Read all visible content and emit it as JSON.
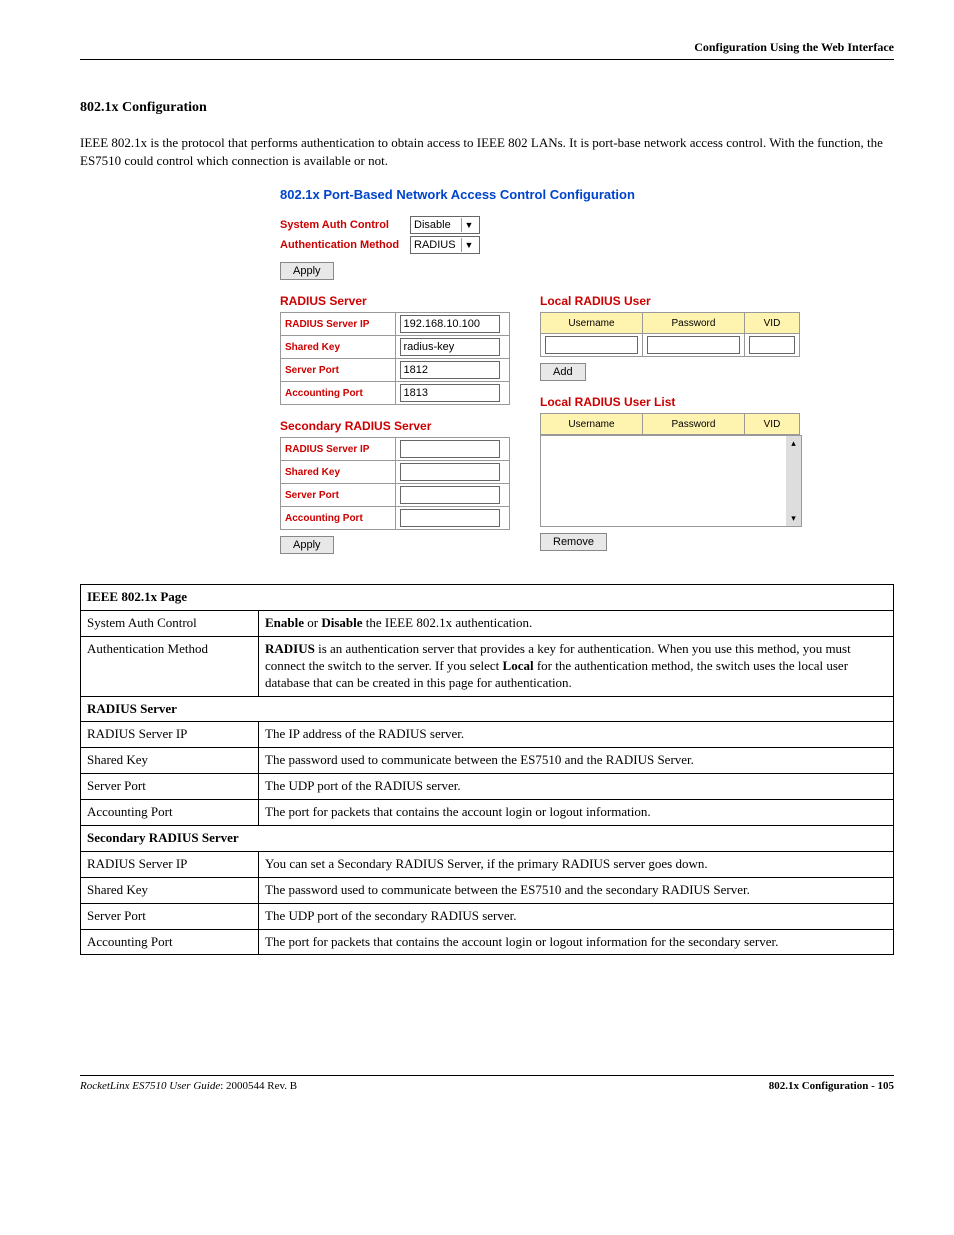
{
  "header": {
    "right": "Configuration Using the Web Interface"
  },
  "section": {
    "title": "802.1x Configuration",
    "paragraph": "IEEE 802.1x is the protocol that performs authentication to obtain access to IEEE 802 LANs. It is port-base network access control. With the function, the ES7510 could control which connection is available or not."
  },
  "panel": {
    "title": "802.1x Port-Based Network Access Control Configuration",
    "sys_auth_label": "System Auth Control",
    "sys_auth_value": "Disable",
    "auth_method_label": "Authentication Method",
    "auth_method_value": "RADIUS",
    "apply": "Apply",
    "radius_server_title": "RADIUS Server",
    "radius": {
      "ip_label": "RADIUS Server IP",
      "ip_value": "192.168.10.100",
      "key_label": "Shared Key",
      "key_value": "radius-key",
      "sport_label": "Server Port",
      "sport_value": "1812",
      "aport_label": "Accounting Port",
      "aport_value": "1813"
    },
    "secondary_title": "Secondary RADIUS Server",
    "secondary": {
      "ip_label": "RADIUS Server IP",
      "ip_value": "",
      "key_label": "Shared Key",
      "key_value": "",
      "sport_label": "Server Port",
      "sport_value": "",
      "aport_label": "Accounting Port",
      "aport_value": ""
    },
    "local_user_title": "Local RADIUS User",
    "local_user_cols": {
      "user": "Username",
      "pass": "Password",
      "vid": "VID"
    },
    "add": "Add",
    "local_list_title": "Local RADIUS User List",
    "remove": "Remove"
  },
  "desc": {
    "header": "IEEE 802.1x Page",
    "rows1": [
      {
        "l": "System Auth Control",
        "r": "<b>Enable</b> or <b>Disable</b> the IEEE 802.1x authentication."
      },
      {
        "l": "Authentication Method",
        "r": "<b>RADIUS</b> is an authentication server that provides a key for authentication. When you use this method, you must connect the switch to the server. If you select <b>Local</b> for the authentication method, the switch uses the local user database that can be created in this page for authentication."
      }
    ],
    "sub1": "RADIUS Server",
    "rows2": [
      {
        "l": "RADIUS Server IP",
        "r": "The IP address of the RADIUS server."
      },
      {
        "l": "Shared Key",
        "r": "The password used to communicate between the ES7510 and the RADIUS Server."
      },
      {
        "l": "Server Port",
        "r": "The UDP port of the RADIUS server."
      },
      {
        "l": "Accounting Port",
        "r": "The port for packets that contains the account login or logout information."
      }
    ],
    "sub2": "Secondary RADIUS Server",
    "rows3": [
      {
        "l": "RADIUS Server IP",
        "r": "You can set a Secondary RADIUS Server, if the primary RADIUS server goes down."
      },
      {
        "l": "Shared Key",
        "r": "The password used to communicate between the ES7510 and the secondary RADIUS Server."
      },
      {
        "l": "Server Port",
        "r": "The UDP port of the secondary RADIUS server."
      },
      {
        "l": "Accounting Port",
        "r": "The port for packets that contains the account login or logout information for the secondary server."
      }
    ]
  },
  "footer": {
    "left_italic": "RocketLinx ES7510  User Guide",
    "left_rest": ": 2000544 Rev. B",
    "right": "802.1x Configuration - 105"
  }
}
